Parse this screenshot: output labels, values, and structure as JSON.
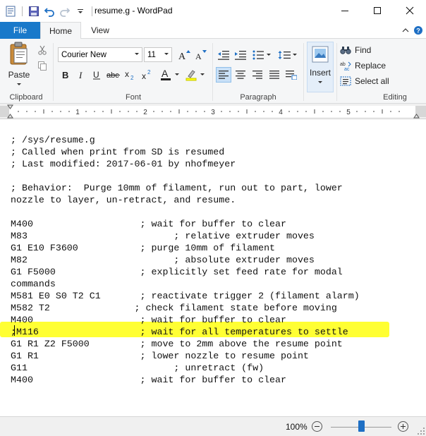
{
  "window": {
    "title": "resume.g - WordPad"
  },
  "tabs": {
    "file": "File",
    "home": "Home",
    "view": "View"
  },
  "clipboard": {
    "paste": "Paste",
    "label": "Clipboard"
  },
  "font": {
    "name": "Courier New",
    "size": "11",
    "label": "Font",
    "colors": {
      "text": "#1f1f1f",
      "highlight": "#ffff00"
    }
  },
  "paragraph": {
    "label": "Paragraph"
  },
  "insert": {
    "label": "Insert"
  },
  "editing": {
    "find": "Find",
    "replace": "Replace",
    "select_all": "Select all",
    "label": "Editing"
  },
  "ruler": {
    "marks": [
      "1",
      "2",
      "3",
      "4",
      "5"
    ]
  },
  "document": {
    "highlighted_line_index": 16,
    "lines": [
      "; /sys/resume.g",
      "; Called when print from SD is resumed",
      "; Last modified: 2017-06-01 by nhofmeyer",
      "",
      "; Behavior:  Purge 10mm of filament, run out to part, lower",
      "nozzle to layer, un-retract, and resume.",
      "",
      "M400                   ; wait for buffer to clear",
      "M83                          ; relative extruder moves",
      "G1 E10 F3600           ; purge 10mm of filament",
      "M82                          ; absolute extruder moves",
      "G1 F5000               ; explicitly set feed rate for modal",
      "commands",
      "M581 E0 S0 T2 C1       ; reactivate trigger 2 (filament alarm)",
      "M582 T2               ; check filament state before moving",
      "M400                   ; wait for buffer to clear",
      ";M116                  ; wait for all temperatures to settle",
      "G1 R1 Z2 F5000         ; move to 2mm above the resume point",
      "G1 R1                  ; lower nozzle to resume point",
      "G11                          ; unretract (fw)",
      "M400                   ; wait for buffer to clear"
    ]
  },
  "status": {
    "zoom": "100%",
    "zoom_level_fraction": 0.5
  },
  "colors": {
    "accent": "#1979ca",
    "highlight": "#ffff33"
  }
}
